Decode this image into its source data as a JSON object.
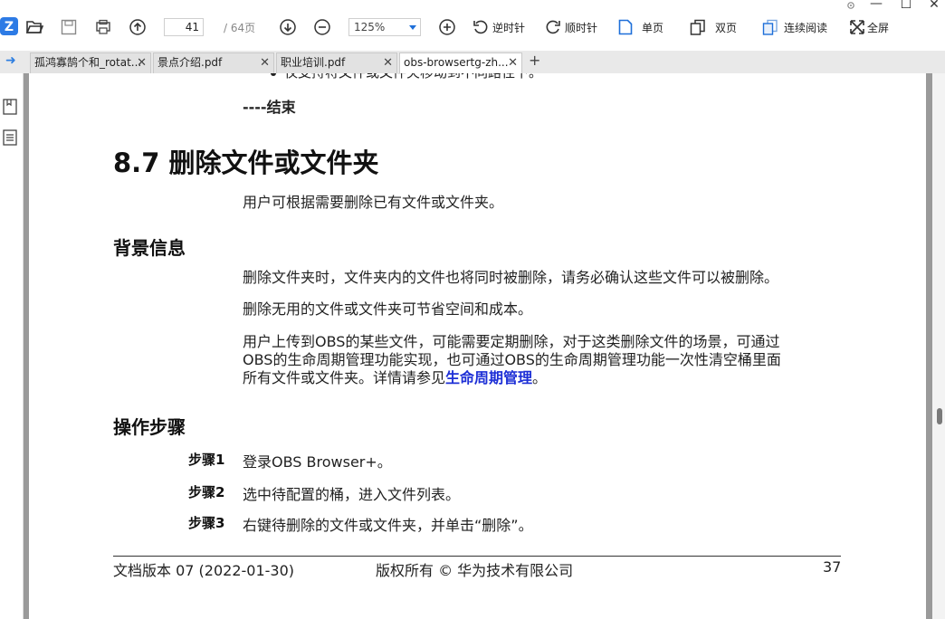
{
  "toolbar": {
    "page_current": "41",
    "page_total": "/ 64页",
    "zoom": "125%",
    "rotate_ccw_label": "逆时针",
    "rotate_cw_label": "顺时针",
    "single_page_label": "单页",
    "double_page_label": "双页",
    "continuous_label": "连续阅读",
    "fullscreen_label": "全屏",
    "accent_color": "#1e6fd9"
  },
  "window": {
    "minimize": "—",
    "maximize": "☐",
    "close": "✕"
  },
  "tabs": [
    {
      "label": "孤鸿寡鹄个和_rotat...",
      "close": "✕"
    },
    {
      "label": "景点介绍.pdf",
      "close": "✕"
    },
    {
      "label": "职业培训.pdf",
      "close": "✕"
    },
    {
      "label": "obs-browsertg-zh...",
      "close": "✕",
      "active": true
    }
  ],
  "tab_add": "+",
  "document": {
    "prev_bullet": "仅支持将文件或文件夹移动到不同路径下。",
    "end_mark": "----结束",
    "section_title": "8.7 删除文件或文件夹",
    "intro": "用户可根据需要删除已有文件或文件夹。",
    "background_title": "背景信息",
    "bg_para1": "删除文件夹时，文件夹内的文件也将同时被删除，请务必确认这些文件可以被删除。",
    "bg_para2": "删除无用的文件或文件夹可节省空间和成本。",
    "bg_para3_line1": "用户上传到OBS的某些文件，可能需要定期删除，对于这类删除文件的场景，可通过",
    "bg_para3_line2": "OBS的生命周期管理功能实现，也可通过OBS的生命周期管理功能一次性清空桶里面",
    "bg_para3_line3_prefix": "所有文件或文件夹。详情请参见",
    "bg_para3_link": "生命周期管理",
    "bg_para3_suffix": "。",
    "steps_title": "操作步骤",
    "steps": [
      {
        "label": "步骤1",
        "text": "登录OBS Browser+。"
      },
      {
        "label": "步骤2",
        "text": "选中待配置的桶，进入文件列表。"
      },
      {
        "label": "步骤3",
        "text": "右键待删除的文件或文件夹，并单击“删除”。"
      }
    ],
    "footer_left": "文档版本 07 (2022-01-30)",
    "footer_center": "版权所有 © 华为技术有限公司",
    "footer_right": "37",
    "link_color": "#1d2fd6"
  }
}
